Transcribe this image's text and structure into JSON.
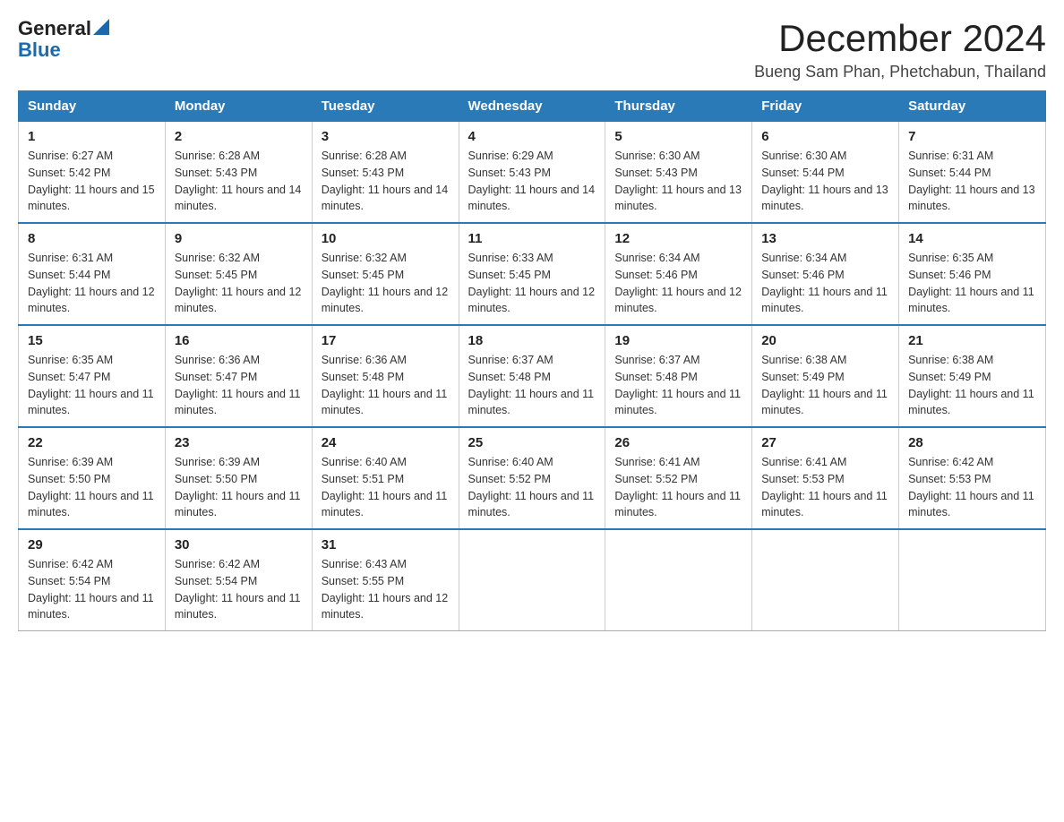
{
  "header": {
    "logo_general": "General",
    "logo_blue": "Blue",
    "month_title": "December 2024",
    "location": "Bueng Sam Phan, Phetchabun, Thailand"
  },
  "days_of_week": [
    "Sunday",
    "Monday",
    "Tuesday",
    "Wednesday",
    "Thursday",
    "Friday",
    "Saturday"
  ],
  "weeks": [
    [
      {
        "day": "1",
        "sunrise": "6:27 AM",
        "sunset": "5:42 PM",
        "daylight": "11 hours and 15 minutes."
      },
      {
        "day": "2",
        "sunrise": "6:28 AM",
        "sunset": "5:43 PM",
        "daylight": "11 hours and 14 minutes."
      },
      {
        "day": "3",
        "sunrise": "6:28 AM",
        "sunset": "5:43 PM",
        "daylight": "11 hours and 14 minutes."
      },
      {
        "day": "4",
        "sunrise": "6:29 AM",
        "sunset": "5:43 PM",
        "daylight": "11 hours and 14 minutes."
      },
      {
        "day": "5",
        "sunrise": "6:30 AM",
        "sunset": "5:43 PM",
        "daylight": "11 hours and 13 minutes."
      },
      {
        "day": "6",
        "sunrise": "6:30 AM",
        "sunset": "5:44 PM",
        "daylight": "11 hours and 13 minutes."
      },
      {
        "day": "7",
        "sunrise": "6:31 AM",
        "sunset": "5:44 PM",
        "daylight": "11 hours and 13 minutes."
      }
    ],
    [
      {
        "day": "8",
        "sunrise": "6:31 AM",
        "sunset": "5:44 PM",
        "daylight": "11 hours and 12 minutes."
      },
      {
        "day": "9",
        "sunrise": "6:32 AM",
        "sunset": "5:45 PM",
        "daylight": "11 hours and 12 minutes."
      },
      {
        "day": "10",
        "sunrise": "6:32 AM",
        "sunset": "5:45 PM",
        "daylight": "11 hours and 12 minutes."
      },
      {
        "day": "11",
        "sunrise": "6:33 AM",
        "sunset": "5:45 PM",
        "daylight": "11 hours and 12 minutes."
      },
      {
        "day": "12",
        "sunrise": "6:34 AM",
        "sunset": "5:46 PM",
        "daylight": "11 hours and 12 minutes."
      },
      {
        "day": "13",
        "sunrise": "6:34 AM",
        "sunset": "5:46 PM",
        "daylight": "11 hours and 11 minutes."
      },
      {
        "day": "14",
        "sunrise": "6:35 AM",
        "sunset": "5:46 PM",
        "daylight": "11 hours and 11 minutes."
      }
    ],
    [
      {
        "day": "15",
        "sunrise": "6:35 AM",
        "sunset": "5:47 PM",
        "daylight": "11 hours and 11 minutes."
      },
      {
        "day": "16",
        "sunrise": "6:36 AM",
        "sunset": "5:47 PM",
        "daylight": "11 hours and 11 minutes."
      },
      {
        "day": "17",
        "sunrise": "6:36 AM",
        "sunset": "5:48 PM",
        "daylight": "11 hours and 11 minutes."
      },
      {
        "day": "18",
        "sunrise": "6:37 AM",
        "sunset": "5:48 PM",
        "daylight": "11 hours and 11 minutes."
      },
      {
        "day": "19",
        "sunrise": "6:37 AM",
        "sunset": "5:48 PM",
        "daylight": "11 hours and 11 minutes."
      },
      {
        "day": "20",
        "sunrise": "6:38 AM",
        "sunset": "5:49 PM",
        "daylight": "11 hours and 11 minutes."
      },
      {
        "day": "21",
        "sunrise": "6:38 AM",
        "sunset": "5:49 PM",
        "daylight": "11 hours and 11 minutes."
      }
    ],
    [
      {
        "day": "22",
        "sunrise": "6:39 AM",
        "sunset": "5:50 PM",
        "daylight": "11 hours and 11 minutes."
      },
      {
        "day": "23",
        "sunrise": "6:39 AM",
        "sunset": "5:50 PM",
        "daylight": "11 hours and 11 minutes."
      },
      {
        "day": "24",
        "sunrise": "6:40 AM",
        "sunset": "5:51 PM",
        "daylight": "11 hours and 11 minutes."
      },
      {
        "day": "25",
        "sunrise": "6:40 AM",
        "sunset": "5:52 PM",
        "daylight": "11 hours and 11 minutes."
      },
      {
        "day": "26",
        "sunrise": "6:41 AM",
        "sunset": "5:52 PM",
        "daylight": "11 hours and 11 minutes."
      },
      {
        "day": "27",
        "sunrise": "6:41 AM",
        "sunset": "5:53 PM",
        "daylight": "11 hours and 11 minutes."
      },
      {
        "day": "28",
        "sunrise": "6:42 AM",
        "sunset": "5:53 PM",
        "daylight": "11 hours and 11 minutes."
      }
    ],
    [
      {
        "day": "29",
        "sunrise": "6:42 AM",
        "sunset": "5:54 PM",
        "daylight": "11 hours and 11 minutes."
      },
      {
        "day": "30",
        "sunrise": "6:42 AM",
        "sunset": "5:54 PM",
        "daylight": "11 hours and 11 minutes."
      },
      {
        "day": "31",
        "sunrise": "6:43 AM",
        "sunset": "5:55 PM",
        "daylight": "11 hours and 12 minutes."
      },
      null,
      null,
      null,
      null
    ]
  ]
}
